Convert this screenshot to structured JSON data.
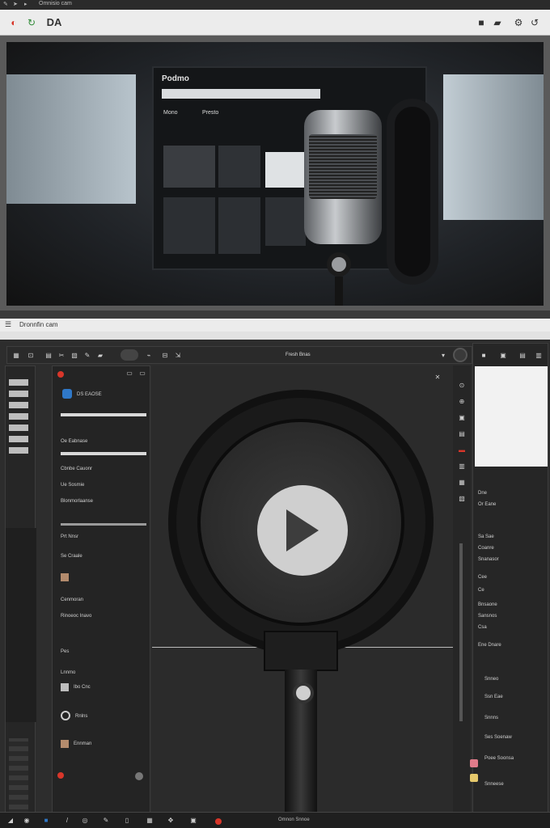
{
  "os_bar": {
    "title": "Omnisio cam"
  },
  "top_toolbar": {
    "logo": "DA"
  },
  "hero": {
    "screen_title": "Podmo",
    "screen_buttons": [
      "Mono",
      "Presto"
    ]
  },
  "app": {
    "title": "Dronnfin cam",
    "canvas_label": "Fresh Bnas",
    "left_panel": {
      "header": "DS EAOSE",
      "items": [
        "Oe Eabnase",
        "Cbnbe Cauonr",
        "Ue Sosmie",
        "Blonmorlaanse",
        "Prt Nnsr",
        "Se Craale",
        "Cenmoran",
        "Rinoeoc Inavo",
        "Pes",
        "Lnnmo",
        "Ibo Cnc",
        "Rnlns",
        "Ennman"
      ]
    },
    "right_panel": {
      "items": [
        "Dne",
        "Or Eane",
        "Sa Sae",
        "Coanre",
        "Snanasor",
        "Cee",
        "Ce",
        "Bnsaone",
        "Sansnos",
        "Csa",
        "Ene Dnare",
        "Snneo",
        "Ssn Eae",
        "Snnns",
        "Ses Soenaw",
        "Poee Soonsa",
        "Snneese"
      ]
    }
  },
  "bottom_bar": {
    "status": "Omnon Snnoe"
  },
  "colors": {
    "accent_red": "#d8362a",
    "accent_blue": "#2f78c8",
    "panel": "#262626"
  }
}
